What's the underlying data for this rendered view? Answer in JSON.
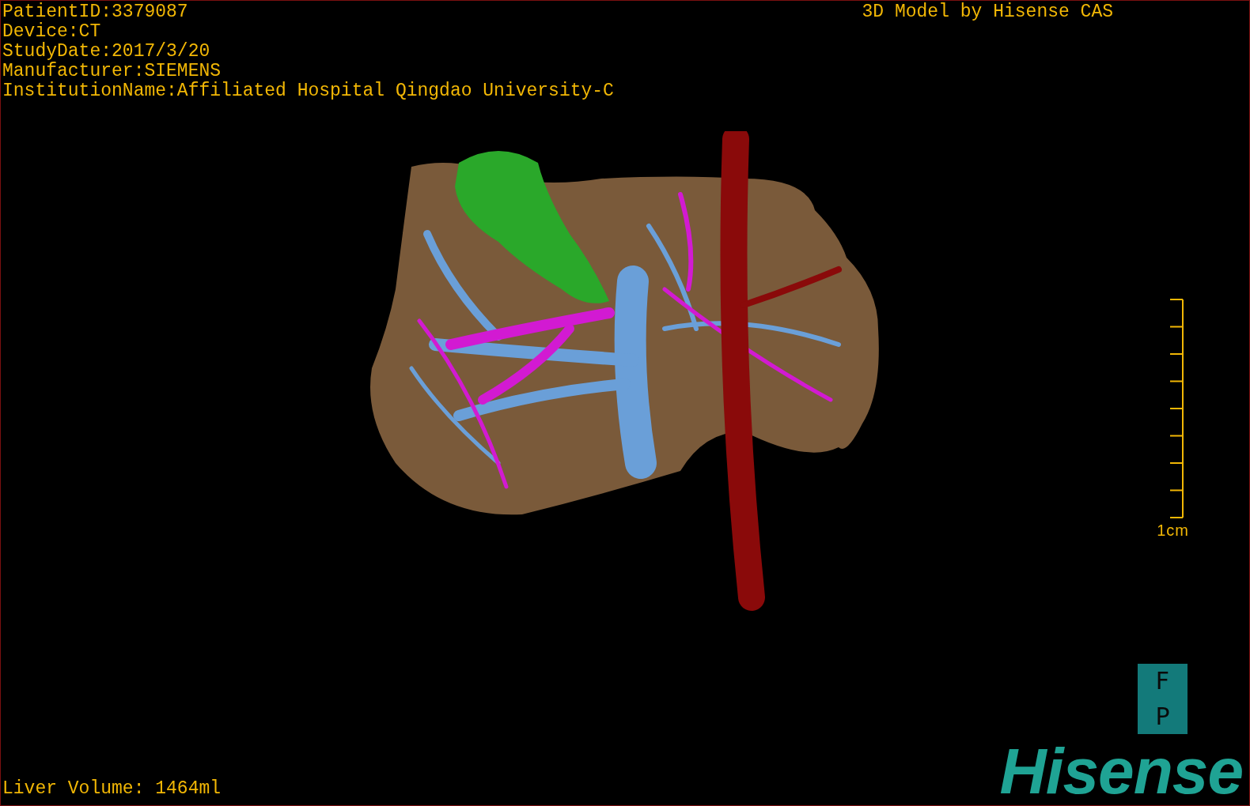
{
  "patient_info": [
    "PatientID:3379087",
    "Device:CT",
    "StudyDate:2017/3/20",
    "Manufacturer:SIEMENS",
    "InstitutionName:Affiliated Hospital Qingdao University-C"
  ],
  "title": "3D Model by Hisense CAS",
  "scale_bar": {
    "label": "1cm"
  },
  "orientation_marker": [
    "F",
    "P"
  ],
  "liver_volume": "Liver Volume: 1464ml",
  "logo": "Hisense"
}
